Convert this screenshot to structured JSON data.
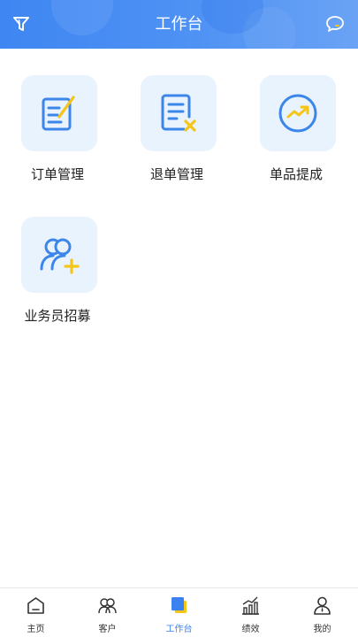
{
  "header": {
    "title": "工作台",
    "left_icon": "filter-icon",
    "right_icon": "chat-bubble-icon"
  },
  "tiles": [
    {
      "label": "订单管理",
      "icon": "order-edit-icon"
    },
    {
      "label": "退单管理",
      "icon": "refund-document-icon"
    },
    {
      "label": "单品提成",
      "icon": "trend-up-icon"
    },
    {
      "label": "业务员招募",
      "icon": "add-user-icon"
    }
  ],
  "tabbar": {
    "items": [
      {
        "label": "主页",
        "icon": "home-icon"
      },
      {
        "label": "客户",
        "icon": "customers-icon"
      },
      {
        "label": "工作台",
        "icon": "workbench-icon",
        "active": true
      },
      {
        "label": "绩效",
        "icon": "bar-chart-icon"
      },
      {
        "label": "我的",
        "icon": "profile-icon"
      }
    ]
  },
  "colors": {
    "primary": "#3f86f2",
    "tile_bg": "#e9f3fe",
    "icon_blue": "#3b86e8",
    "icon_yellow": "#f5c518",
    "active_tab": "#3b82f0"
  }
}
